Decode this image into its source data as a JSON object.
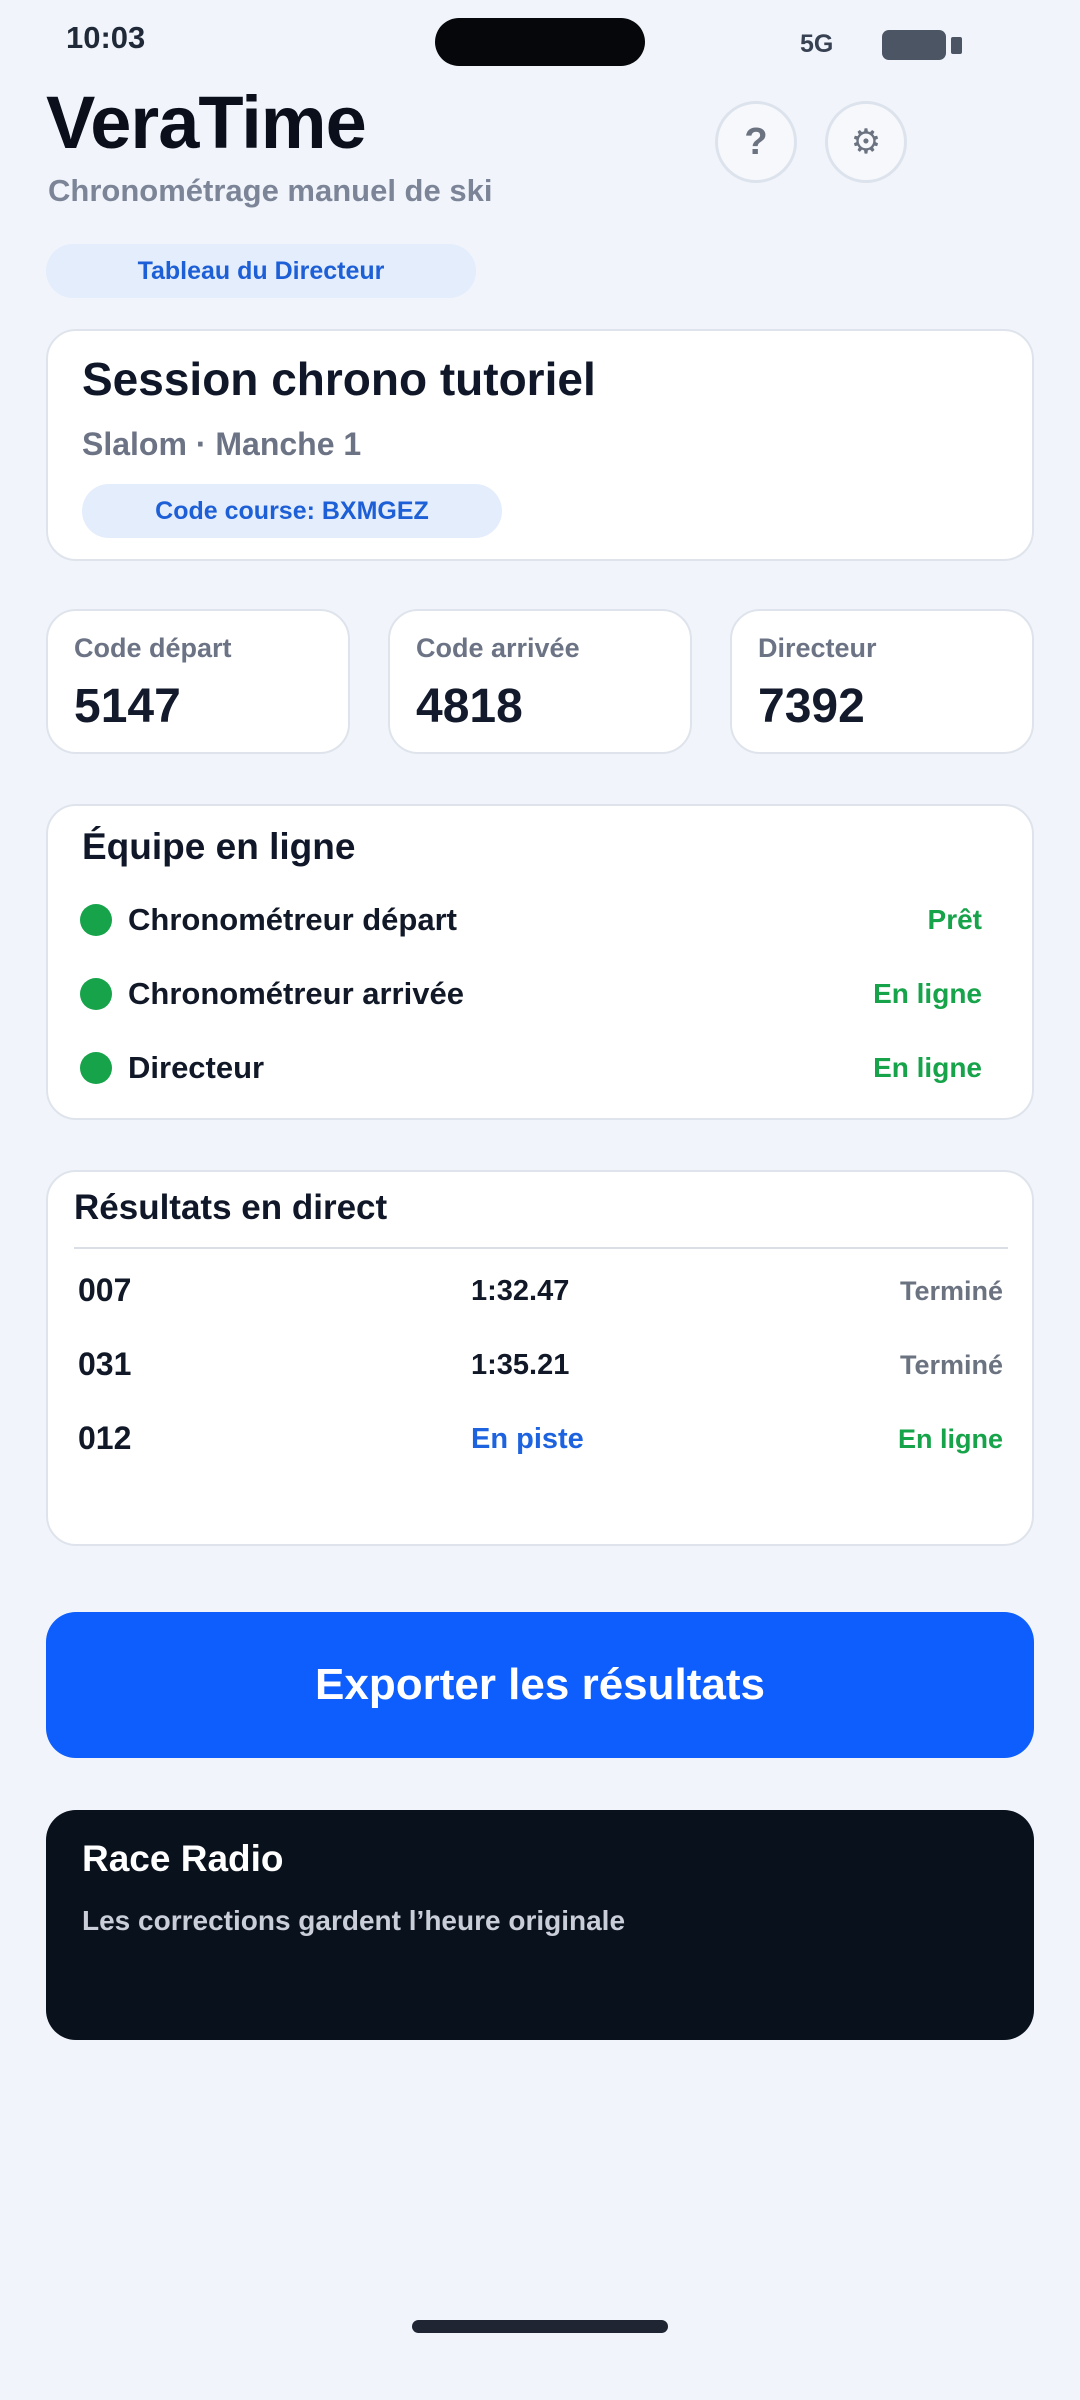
{
  "status_bar": {
    "time": "10:03",
    "network": "5G"
  },
  "header": {
    "title": "VeraTime",
    "subtitle": "Chronométrage manuel de ski",
    "help_icon": "help-icon",
    "help_glyph": "?",
    "settings_icon": "gear-icon",
    "settings_glyph": "⚙"
  },
  "role_badge": "Tableau du Directeur",
  "session": {
    "name": "Session chrono tutoriel",
    "meta": "Slalom · Manche 1",
    "race_code": "Code course: BXMGEZ"
  },
  "codes": [
    {
      "label": "Code départ",
      "value": "5147"
    },
    {
      "label": "Code arrivée",
      "value": "4818"
    },
    {
      "label": "Directeur",
      "value": "7392"
    }
  ],
  "team": {
    "title": "Équipe en ligne",
    "members": [
      {
        "name": "Chronométreur départ",
        "status": "Prêt"
      },
      {
        "name": "Chronométreur arrivée",
        "status": "En ligne"
      },
      {
        "name": "Directeur",
        "status": "En ligne"
      }
    ]
  },
  "results": {
    "title": "Résultats en direct",
    "rows": [
      {
        "bib": "007",
        "time": "1:32.47",
        "status": "Terminé"
      },
      {
        "bib": "031",
        "time": "1:35.21",
        "status": "Terminé"
      },
      {
        "bib": "012",
        "time": "En piste",
        "status": "En ligne"
      }
    ]
  },
  "export_label": "Exporter les résultats",
  "radio": {
    "title": "Race Radio",
    "message": "Les corrections gardent l’heure originale"
  },
  "colors": {
    "accent": "#0d5efc",
    "online": "#16a34a",
    "badge_bg": "#e4edfc",
    "radio_bg": "#09111c"
  }
}
